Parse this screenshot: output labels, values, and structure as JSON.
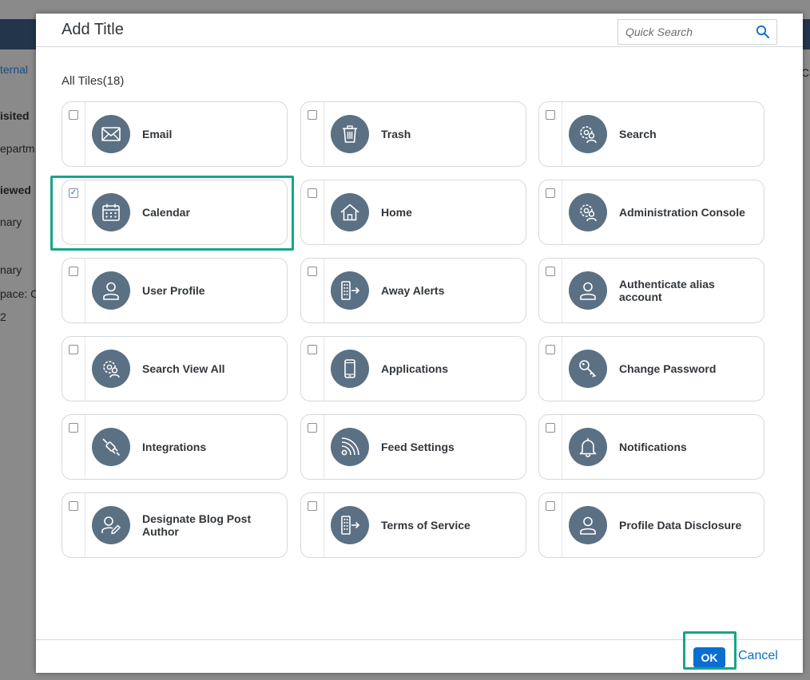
{
  "background": {
    "fragments": [
      {
        "text": "ternal",
        "style": "link"
      },
      {
        "text": "isited",
        "style": "bold"
      },
      {
        "text": "epartm",
        "style": "plain"
      },
      {
        "text": "iewed",
        "style": "bold"
      },
      {
        "text": "nary",
        "style": "plain"
      },
      {
        "text": "nary",
        "style": "plain"
      },
      {
        "text": "pace: C",
        "style": "plain"
      },
      {
        "text": "2",
        "style": "plain"
      },
      {
        "text": "Ca",
        "style": "plain"
      }
    ]
  },
  "dialog": {
    "title": "Add Title",
    "search": {
      "placeholder": "Quick Search",
      "value": ""
    },
    "section_label": "All Tiles(18)",
    "tiles": [
      {
        "label": "Email",
        "icon": "envelope-icon",
        "checked": false
      },
      {
        "label": "Trash",
        "icon": "trash-icon",
        "checked": false
      },
      {
        "label": "Search",
        "icon": "user-settings-icon",
        "checked": false
      },
      {
        "label": "Calendar",
        "icon": "calendar-icon",
        "checked": true
      },
      {
        "label": "Home",
        "icon": "home-icon",
        "checked": false
      },
      {
        "label": "Administration Console",
        "icon": "user-settings-icon",
        "checked": false
      },
      {
        "label": "User Profile",
        "icon": "person-icon",
        "checked": false
      },
      {
        "label": "Away Alerts",
        "icon": "building-exit-icon",
        "checked": false
      },
      {
        "label": "Authenticate alias account",
        "icon": "person-icon",
        "checked": false
      },
      {
        "label": "Search View All",
        "icon": "user-settings-icon",
        "checked": false
      },
      {
        "label": "Applications",
        "icon": "mobile-icon",
        "checked": false
      },
      {
        "label": "Change Password",
        "icon": "key-icon",
        "checked": false
      },
      {
        "label": "Integrations",
        "icon": "plug-icon",
        "checked": false
      },
      {
        "label": "Feed Settings",
        "icon": "feed-icon",
        "checked": false
      },
      {
        "label": "Notifications",
        "icon": "bell-icon",
        "checked": false
      },
      {
        "label": "Designate Blog Post Author",
        "icon": "person-edit-icon",
        "checked": false
      },
      {
        "label": "Terms of Service",
        "icon": "building-exit-icon",
        "checked": false
      },
      {
        "label": "Profile Data Disclosure",
        "icon": "person-icon",
        "checked": false
      }
    ],
    "footer": {
      "ok_label": "OK",
      "cancel_label": "Cancel"
    }
  },
  "colors": {
    "accent": "#0a6ed1",
    "icon_bg": "#5b7083",
    "highlight": "#17a589",
    "title_text": "#32363a"
  }
}
